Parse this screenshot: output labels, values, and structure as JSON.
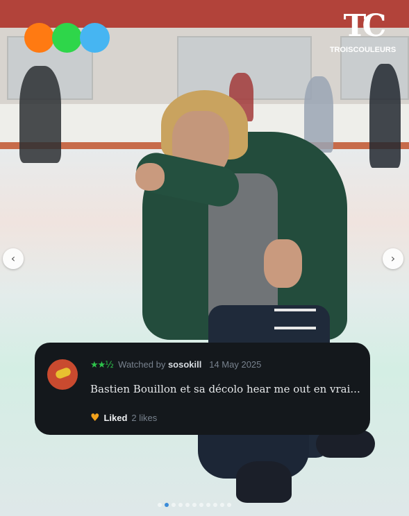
{
  "logo_colors": [
    "#ff7a12",
    "#2ed64a",
    "#46b5f2"
  ],
  "brand": {
    "mark": "TC",
    "name": "TROISCOULEURS"
  },
  "nav": {
    "prev_icon": "chevron-left-icon",
    "next_icon": "chevron-right-icon"
  },
  "review": {
    "stars": "★★½",
    "watched_by_label": "Watched by",
    "username": "sosokill",
    "date": "14 May 2025",
    "text": "Bastien Bouillon et sa décolo hear me out en vrai...",
    "liked_label": "Liked",
    "likes": "2 likes",
    "star_color": "#2ec44b",
    "heart_color": "#f3a21c"
  },
  "pagination": {
    "total": 11,
    "active_index": 1
  }
}
